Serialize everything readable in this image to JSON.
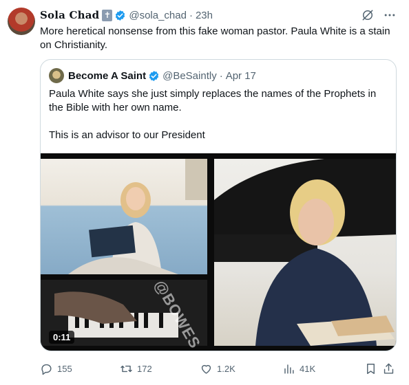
{
  "tweet": {
    "author_name": "Sola Chad",
    "cross_badge": "✝",
    "handle": "@sola_chad",
    "dot": "·",
    "time": "23h",
    "text": "More heretical nonsense from this fake woman pastor. Paula White is a stain on Christianity."
  },
  "quoted": {
    "author_name": "Become A Saint",
    "handle": "@BeSaintly",
    "dot": "·",
    "date": "Apr 17",
    "text_line1": "Paula White says she just simply replaces the names of the Prophets in the Bible with her own name.",
    "text_line2": "This is an advisor to our President",
    "media": {
      "duration": "0:11",
      "watermark": "@BOWES"
    }
  },
  "actions": {
    "replies": "155",
    "reposts": "172",
    "likes": "1.2K",
    "views": "41K"
  },
  "colors": {
    "verified": "#1d9bf0",
    "secondary_text": "#536471",
    "border": "#cfd9de"
  },
  "icons": [
    "grok-icon",
    "more-icon",
    "verified-icon",
    "reply-icon",
    "repost-icon",
    "like-icon",
    "views-icon",
    "bookmark-icon",
    "share-icon"
  ]
}
